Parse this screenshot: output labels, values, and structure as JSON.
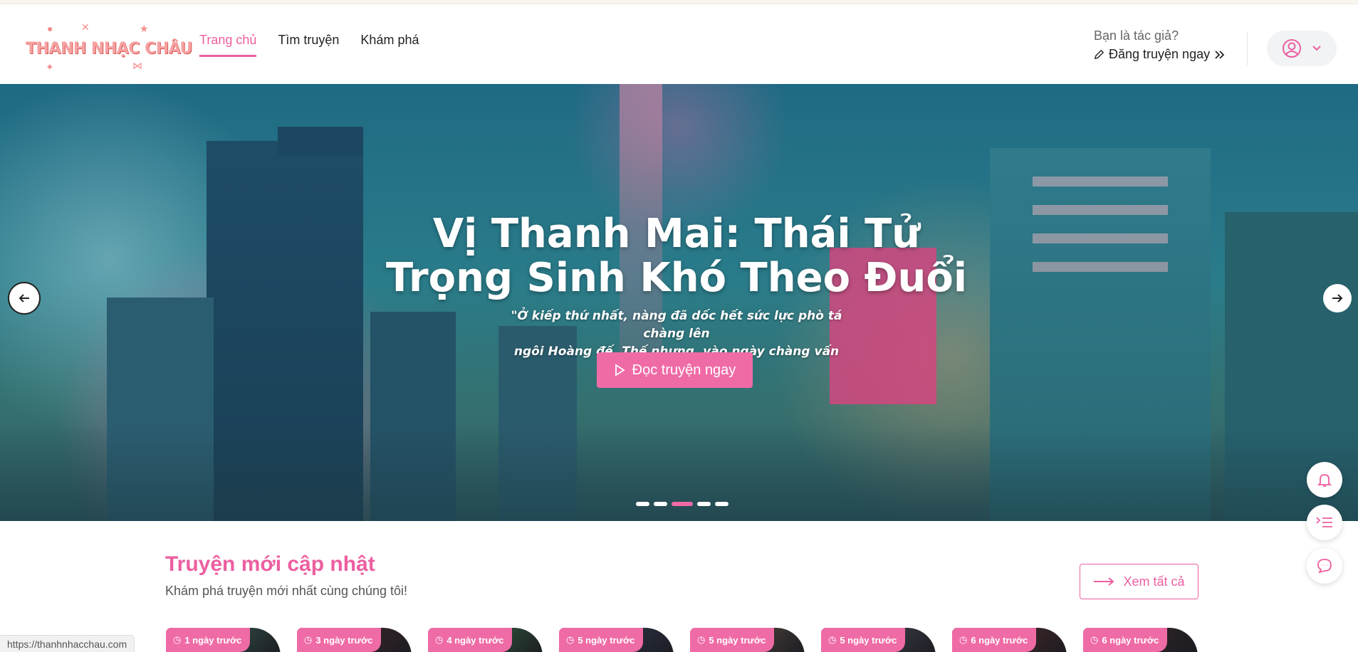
{
  "header": {
    "logo_text": "THANH NHẠC CHÂU",
    "nav": [
      {
        "label": "Trang chủ",
        "active": true
      },
      {
        "label": "Tìm truyện",
        "active": false
      },
      {
        "label": "Khám phá",
        "active": false
      }
    ],
    "author_question": "Bạn là tác giả?",
    "author_cta": "Đăng truyện ngay"
  },
  "hero": {
    "title_line1": "Vị Thanh Mai: Thái Tử",
    "title_line2": "Trọng Sinh Khó Theo Đuổi",
    "quote_line1": "\"Ở kiếp thứ nhất, nàng đã dốc hết sức lực phò tá chàng lên",
    "quote_line2": "ngôi Hoàng đế. Thế nhưng, vào ngày chàng vấn đỉnh thiên..",
    "read_button": "Đọc truyện ngay",
    "slides_count": 5,
    "active_slide": 3
  },
  "section": {
    "title": "Truyện mới cập nhật",
    "subtitle": "Khám phá truyện mới nhất cùng chúng tôi!",
    "see_all": "Xem tất cả"
  },
  "cards": [
    {
      "time": "1 ngày trước",
      "color": "#3f6b5c"
    },
    {
      "time": "3 ngày trước",
      "color": "#4a2a2e"
    },
    {
      "time": "4 ngày trước",
      "color": "#3c7a4a"
    },
    {
      "time": "5 ngày trước",
      "color": "#34405c"
    },
    {
      "time": "5 ngày trước",
      "color": "#6b5a4c"
    },
    {
      "time": "5 ngày trước",
      "color": "#4e5560"
    },
    {
      "time": "6 ngày trước",
      "color": "#5a2e2a"
    },
    {
      "time": "6 ngày trước",
      "color": "#3a2a2a"
    }
  ],
  "status_url": "https://thanhnhacchau.com",
  "colors": {
    "accent": "#ec5fa0",
    "button": "#ef6ba6"
  }
}
